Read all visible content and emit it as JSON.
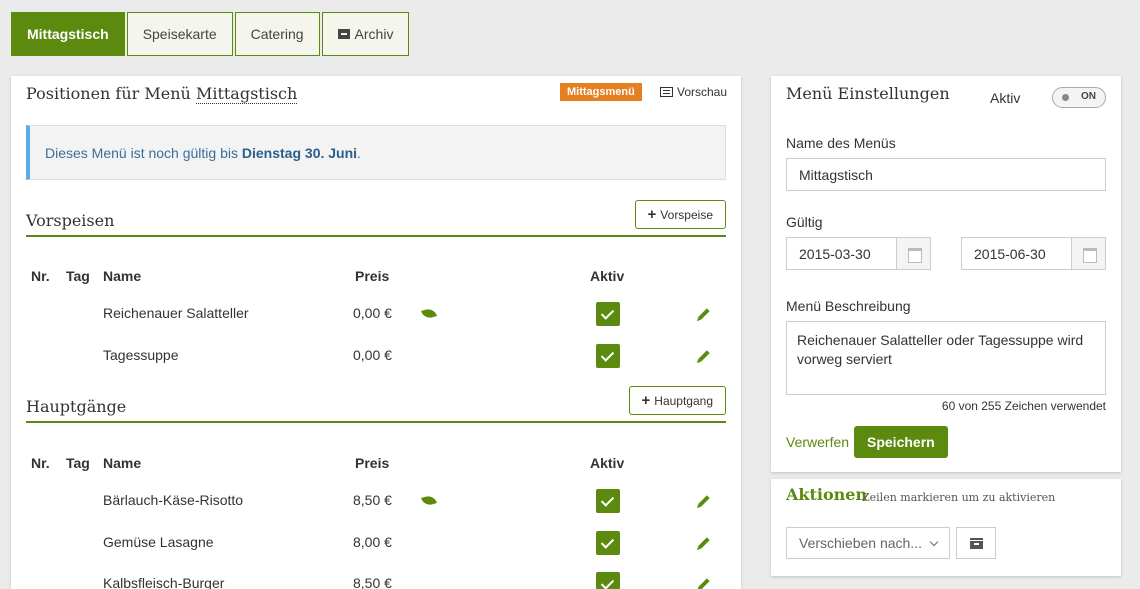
{
  "tabs": [
    {
      "label": "Mittagstisch",
      "active": true
    },
    {
      "label": "Speisekarte",
      "active": false
    },
    {
      "label": "Catering",
      "active": false
    },
    {
      "label": "Archiv",
      "active": false,
      "icon": "archive-icon"
    }
  ],
  "positions": {
    "title_prefix": "Positionen für Menü",
    "title_menu": "Mittagstisch",
    "badge": "Mittagsmenü",
    "preview_label": "Vorschau",
    "info_prefix": "Dieses Menü ist noch gültig bis",
    "info_date": "Dienstag 30. Juni",
    "info_suffix": "."
  },
  "columns": {
    "nr": "Nr.",
    "tag": "Tag",
    "name": "Name",
    "price": "Preis",
    "active": "Aktiv"
  },
  "sections": [
    {
      "title": "Vorspeisen",
      "add_label": "Vorspeise",
      "rows": [
        {
          "name": "Reichenauer Salatteller",
          "price": "0,00 €",
          "vegetarian": true,
          "active": true
        },
        {
          "name": "Tagessuppe",
          "price": "0,00 €",
          "vegetarian": false,
          "active": true
        }
      ]
    },
    {
      "title": "Hauptgänge",
      "add_label": "Hauptgang",
      "rows": [
        {
          "name": "Bärlauch-Käse-Risotto",
          "price": "8,50 €",
          "vegetarian": true,
          "active": true
        },
        {
          "name": "Gemüse Lasagne",
          "price": "8,00 €",
          "vegetarian": false,
          "active": true
        },
        {
          "name": "Kalbsfleisch-Burger",
          "price": "8,50 €",
          "vegetarian": false,
          "active": true
        }
      ]
    }
  ],
  "settings": {
    "title": "Menü Einstellungen",
    "active_label": "Aktiv",
    "toggle_label": "ON",
    "name_label": "Name des Menüs",
    "name_value": "Mittagstisch",
    "valid_label": "Gültig",
    "valid_from": "2015-03-30",
    "valid_to": "2015-06-30",
    "desc_label": "Menü Beschreibung",
    "desc_value": "Reichenauer Salatteller oder Tagessuppe wird vorweg serviert",
    "counter": "60 von 255 Zeichen verwendet",
    "discard_label": "Verwerfen",
    "save_label": "Speichern"
  },
  "actions": {
    "title": "Aktionen",
    "hint": "Zeilen markieren um zu aktivieren",
    "move_label": "Verschieben nach...",
    "archive_icon": "archive-icon"
  },
  "colors": {
    "brand_green": "#5b8a0e",
    "badge_orange": "#e67e22",
    "info_blue": "#5aaee8"
  }
}
